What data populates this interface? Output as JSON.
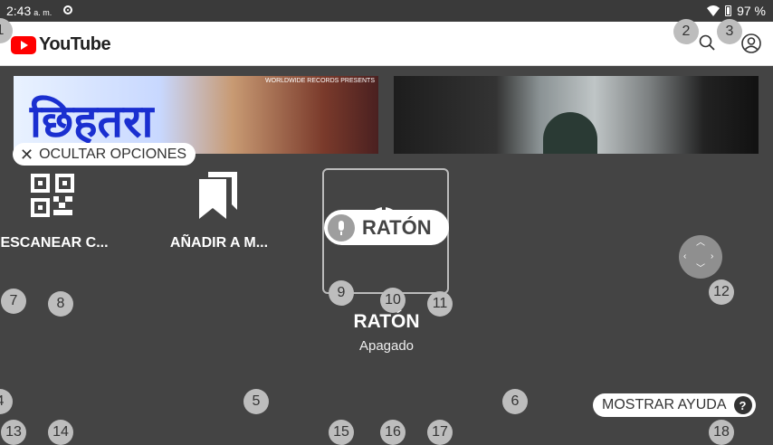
{
  "status_bar": {
    "time": "2:43",
    "ampm": "a. m.",
    "battery": "97 %"
  },
  "app": {
    "logo_text": "YouTube"
  },
  "thumbnails": [
    {
      "title_text": "छिहतरा",
      "label": "WORLDWIDE RECORDS PRESENTS"
    },
    {}
  ],
  "controls": {
    "hide_options_label": "OCULTAR OPCIONES",
    "scan_label": "ESCANEAR C...",
    "add_label": "AÑADIR A M...",
    "mouse_pill_label": "RATÓN",
    "mouse_title": "RATÓN",
    "mouse_status": "Apagado",
    "show_help_label": "MOSTRAR AYUDA",
    "help_icon": "?"
  },
  "badges": [
    "1",
    "2",
    "3",
    "4",
    "5",
    "6",
    "7",
    "8",
    "9",
    "10",
    "11",
    "12",
    "13",
    "14",
    "15",
    "16",
    "17",
    "18"
  ],
  "colors": {
    "overlay": "#444444",
    "youtube_red": "#ff0000",
    "badge": "#bdbdbd"
  }
}
